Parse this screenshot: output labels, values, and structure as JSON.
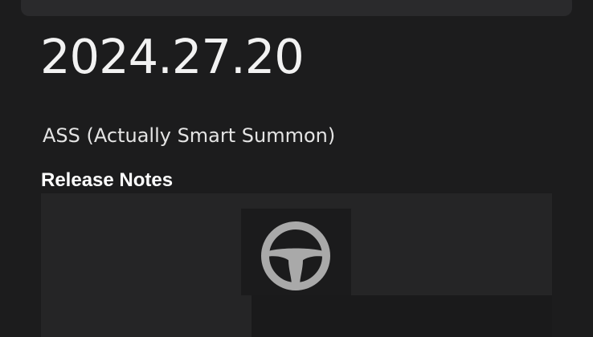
{
  "release": {
    "version": "2024.27.20",
    "feature_title": "ASS (Actually Smart Summon)",
    "section_heading": "Release Notes",
    "feature_icon": "steering-wheel-icon"
  },
  "colors": {
    "background": "#1c1c1d",
    "text_primary": "#f2f2f2",
    "icon": "#a9a9a9"
  }
}
